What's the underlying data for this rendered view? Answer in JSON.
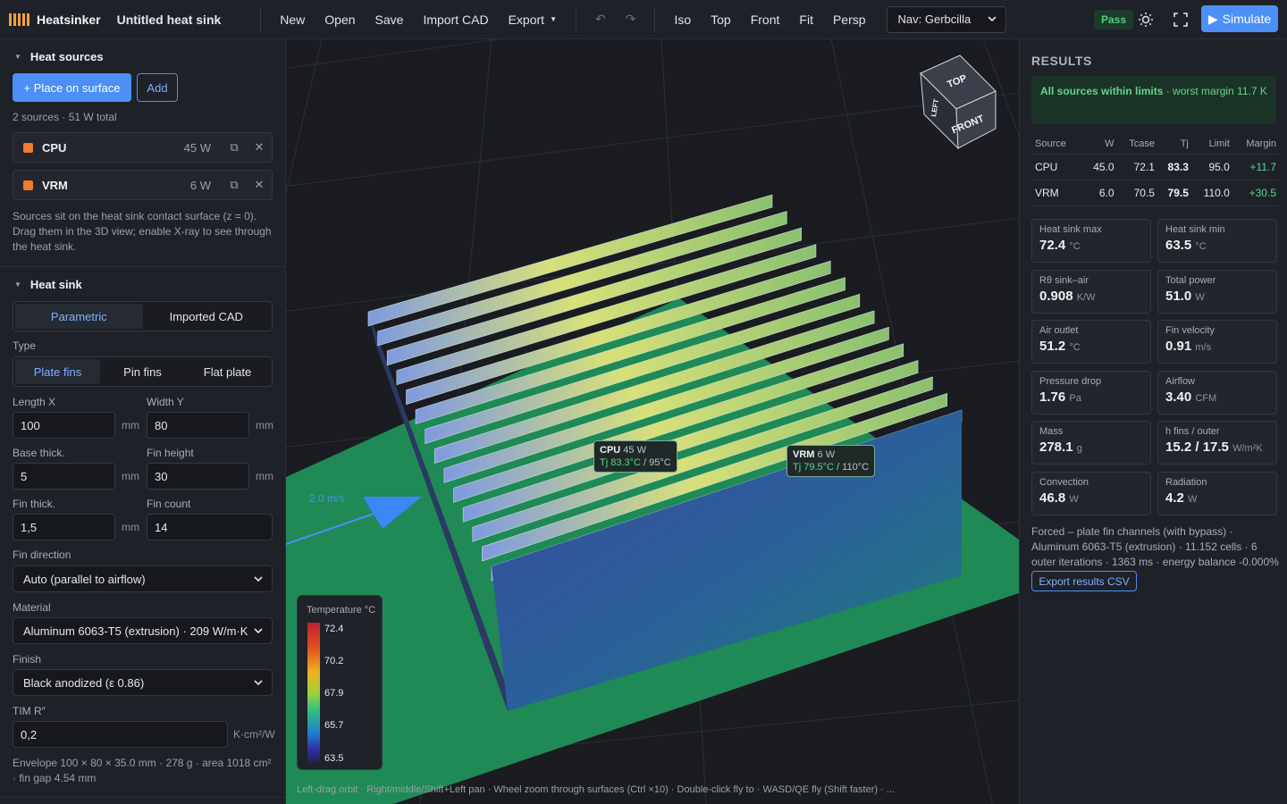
{
  "app": {
    "name": "Heatsinker",
    "document_title": "Untitled heat sink"
  },
  "toolbar": {
    "new": "New",
    "open": "Open",
    "save": "Save",
    "import_cad": "Import CAD",
    "export": "Export",
    "undo": "↶",
    "redo": "↷",
    "views": [
      "Iso",
      "Top",
      "Front",
      "Fit",
      "Persp"
    ],
    "nav_mode": "Nav: Gerbcilla",
    "status": "Pass",
    "simulate": "Simulate"
  },
  "heat_sources": {
    "title": "Heat sources",
    "place_button": "+ Place on surface",
    "add_button": "Add",
    "summary": "2 sources · 51 W total",
    "items": [
      {
        "name": "CPU",
        "power": "45 W"
      },
      {
        "name": "VRM",
        "power": "6 W"
      }
    ],
    "note": "Sources sit on the heat sink contact surface (z = 0). Drag them in the 3D view; enable X-ray to see through the heat sink."
  },
  "heat_sink": {
    "title": "Heat sink",
    "mode_tabs": [
      "Parametric",
      "Imported CAD"
    ],
    "active_mode": "Parametric",
    "type_label": "Type",
    "type_tabs": [
      "Plate fins",
      "Pin fins",
      "Flat plate"
    ],
    "active_type": "Plate fins",
    "fields": {
      "length_x": {
        "label": "Length X",
        "value": "100",
        "unit": "mm"
      },
      "width_y": {
        "label": "Width Y",
        "value": "80",
        "unit": "mm"
      },
      "base_thick": {
        "label": "Base thick.",
        "value": "5",
        "unit": "mm"
      },
      "fin_height": {
        "label": "Fin height",
        "value": "30",
        "unit": "mm"
      },
      "fin_thick": {
        "label": "Fin thick.",
        "value": "1,5",
        "unit": "mm"
      },
      "fin_count": {
        "label": "Fin count",
        "value": "14"
      }
    },
    "fin_direction": {
      "label": "Fin direction",
      "value": "Auto (parallel to airflow)"
    },
    "material": {
      "label": "Material",
      "value": "Aluminum 6063-T5 (extrusion) · 209 W/m·K"
    },
    "finish": {
      "label": "Finish",
      "value": "Black anodized (ε 0.86)"
    },
    "tim": {
      "label": "TIM R″",
      "value": "0,2",
      "unit": "K·cm²/W"
    },
    "envelope_note": "Envelope 100 × 80 × 35.0 mm · 278 g · area 1018 cm² · fin gap 4.54 mm"
  },
  "viewport": {
    "cube_faces": {
      "top": "TOP",
      "front": "FRONT",
      "left": "LEFT"
    },
    "flow_speed": "2.0 m/s",
    "tags": [
      {
        "name": "CPU",
        "power": "45 W",
        "tj": "Tj 83.3°C",
        "limit": "/ 95°C"
      },
      {
        "name": "VRM",
        "power": "6 W",
        "tj": "Tj 79.5°C",
        "limit": "/ 110°C"
      }
    ],
    "legend": {
      "title": "Temperature °C",
      "ticks": [
        "72.4",
        "70.2",
        "67.9",
        "65.7",
        "63.5"
      ]
    },
    "hint": "Left-drag orbit · Right/middle/Shift+Left pan · Wheel zoom through surfaces (Ctrl ×10) · Double-click fly to · WASD/QE fly (Shift faster) · ..."
  },
  "results": {
    "title": "RESULTS",
    "status_bold": "All sources within limits",
    "status_rest": " · worst margin 11.7 K",
    "columns": [
      "Source",
      "W",
      "Tcase",
      "Tj",
      "Limit",
      "Margin"
    ],
    "rows": [
      [
        "CPU",
        "45.0",
        "72.1",
        "83.3",
        "95.0",
        "+11.7"
      ],
      [
        "VRM",
        "6.0",
        "70.5",
        "79.5",
        "110.0",
        "+30.5"
      ]
    ],
    "cards": [
      {
        "label": "Heat sink max",
        "value": "72.4",
        "unit": "°C"
      },
      {
        "label": "Heat sink min",
        "value": "63.5",
        "unit": "°C"
      },
      {
        "label": "Rθ sink–air",
        "value": "0.908",
        "unit": "K/W"
      },
      {
        "label": "Total power",
        "value": "51.0",
        "unit": "W"
      },
      {
        "label": "Air outlet",
        "value": "51.2",
        "unit": "°C"
      },
      {
        "label": "Fin velocity",
        "value": "0.91",
        "unit": "m/s"
      },
      {
        "label": "Pressure drop",
        "value": "1.76",
        "unit": "Pa"
      },
      {
        "label": "Airflow",
        "value": "3.40",
        "unit": "CFM"
      },
      {
        "label": "Mass",
        "value": "278.1",
        "unit": "g"
      },
      {
        "label": "h fins / outer",
        "value": "15.2 / 17.5",
        "unit": "W/m²K"
      },
      {
        "label": "Convection",
        "value": "46.8",
        "unit": "W"
      },
      {
        "label": "Radiation",
        "value": "4.2",
        "unit": "W"
      }
    ],
    "footer": "Forced – plate fin channels (with bypass) · Aluminum 6063-T5 (extrusion) · 11.152 cells · 6 outer iterations · 1363 ms · energy balance -0.000%",
    "export_button": "Export results CSV"
  }
}
